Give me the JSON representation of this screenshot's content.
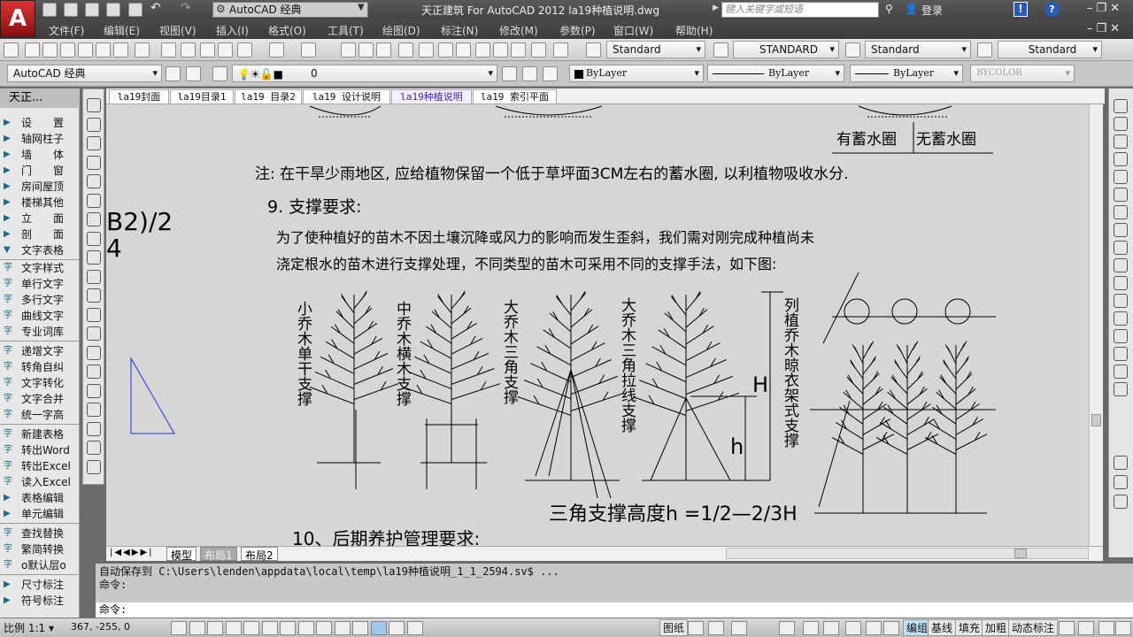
{
  "app": {
    "logo": "A",
    "workspace": "AutoCAD 经典",
    "title": "天正建筑 For AutoCAD 2012     la19种植说明.dwg",
    "search_placeholder": "键入关键字或短语",
    "login": "登录"
  },
  "menu": [
    "文件(F)",
    "编辑(E)",
    "视图(V)",
    "插入(I)",
    "格式(O)",
    "工具(T)",
    "绘图(D)",
    "标注(N)",
    "修改(M)",
    "参数(P)",
    "窗口(W)",
    "帮助(H)"
  ],
  "styles": {
    "text_style": "Standard",
    "dim_style": "STANDARD",
    "table_style": "Standard",
    "mleader_style": "Standard"
  },
  "layers": {
    "workspace": "AutoCAD 经典",
    "current_layer": "0",
    "color": "ByLayer",
    "linetype": "ByLayer",
    "lineweight": "ByLayer",
    "plotstyle": "BYCOLOR"
  },
  "sidebar": {
    "title": "天正...",
    "groups": [
      "设　　置",
      "轴网柱子",
      "墙　　体",
      "门　　窗",
      "房间屋顶",
      "楼梯其他",
      "立　　面",
      "剖　　面",
      "文字表格"
    ],
    "text_items": [
      "文字样式",
      "单行文字",
      "多行文字",
      "曲线文字",
      "专业词库"
    ],
    "text_items2": [
      "递增文字",
      "转角自纠",
      "文字转化",
      "文字合并",
      "统一字高"
    ],
    "table_items": [
      "新建表格",
      "转出Word",
      "转出Excel",
      "读入Excel",
      "表格编辑",
      "单元编辑"
    ],
    "misc_items": [
      "查找替换",
      "繁简转换",
      "o默认层o"
    ],
    "bottom": [
      "尺寸标注",
      "符号标注"
    ]
  },
  "tabs": [
    "la19封面",
    "la19目录1",
    "la19 目录2",
    "la19 设计说明",
    "la19种植说明",
    "la19 索引平面"
  ],
  "active_tab": 4,
  "drawing": {
    "legend": [
      "有蓄水圈",
      "无蓄水圈"
    ],
    "note": "注: 在干旱少雨地区, 应给植物保留一个低于草坪面3CM左右的蓄水圈, 以利植物吸收水分.",
    "section9": "9. 支撑要求:",
    "para1": "为了使种植好的苗木不因土壤沉降或风力的影响而发生歪斜，我们需对刚完成种植尚未",
    "para2": "浇定根水的苗木进行支撑处理，不同类型的苗木可采用不同的支撑手法，如下图:",
    "side_text1": "B2)/2",
    "side_text2": "4",
    "labels": [
      "小乔木单干支撑",
      "中乔木横木支撑",
      "大乔木三角支撑",
      "大乔木三角拉线支撑",
      "列植乔木晾衣架式支撑"
    ],
    "dim_H": "H",
    "dim_h": "h",
    "formula": "三角支撑高度h =1/2—2/3H",
    "section10": "10、后期养护管理要求:"
  },
  "layout_tabs": [
    "模型",
    "布局1",
    "布局2"
  ],
  "command": {
    "history1": "自动保存到 C:\\Users\\lenden\\appdata\\local\\temp\\la19种植说明_1_1_2594.sv$ ...",
    "history2": "命令:",
    "prompt": "命令:"
  },
  "status": {
    "scale": "比例 1:1",
    "coords": "367, -255, 0",
    "paper": "图纸",
    "toggles": [
      "编组",
      "基线",
      "填充",
      "加粗",
      "动态标注"
    ]
  }
}
